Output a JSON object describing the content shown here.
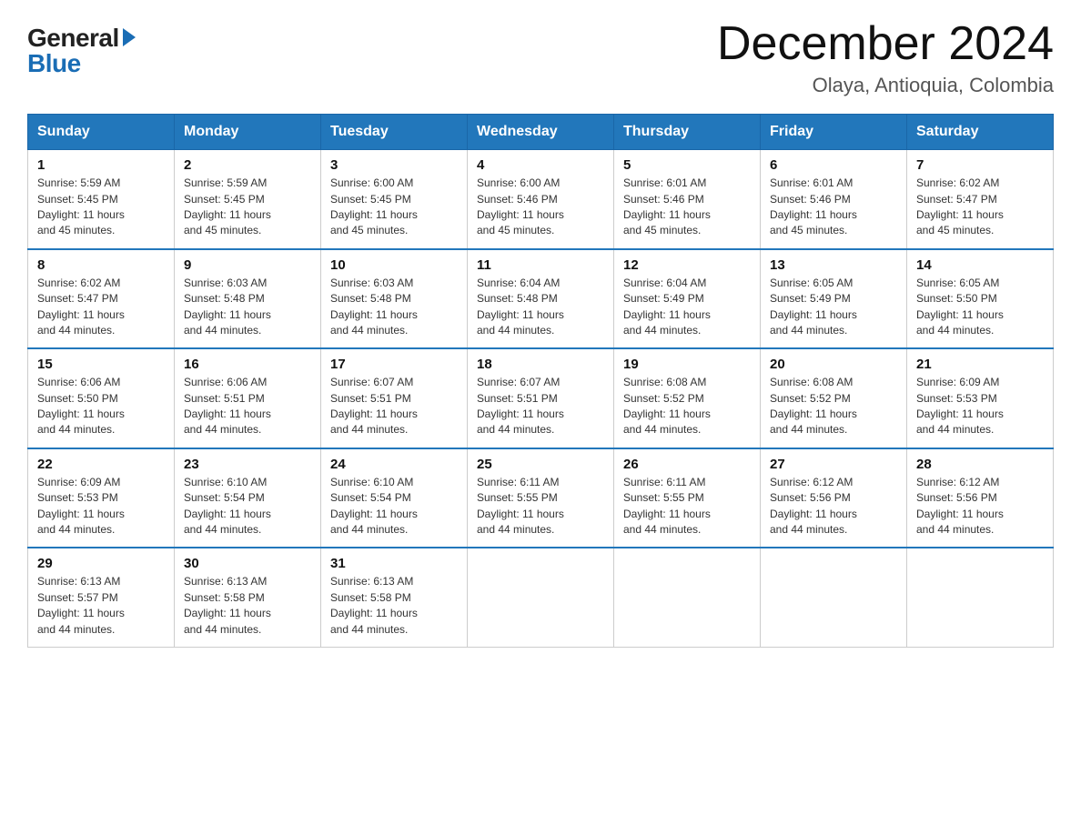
{
  "logo": {
    "general": "General",
    "blue": "Blue"
  },
  "title": "December 2024",
  "subtitle": "Olaya, Antioquia, Colombia",
  "headers": [
    "Sunday",
    "Monday",
    "Tuesday",
    "Wednesday",
    "Thursday",
    "Friday",
    "Saturday"
  ],
  "weeks": [
    [
      {
        "day": "1",
        "info": "Sunrise: 5:59 AM\nSunset: 5:45 PM\nDaylight: 11 hours\nand 45 minutes."
      },
      {
        "day": "2",
        "info": "Sunrise: 5:59 AM\nSunset: 5:45 PM\nDaylight: 11 hours\nand 45 minutes."
      },
      {
        "day": "3",
        "info": "Sunrise: 6:00 AM\nSunset: 5:45 PM\nDaylight: 11 hours\nand 45 minutes."
      },
      {
        "day": "4",
        "info": "Sunrise: 6:00 AM\nSunset: 5:46 PM\nDaylight: 11 hours\nand 45 minutes."
      },
      {
        "day": "5",
        "info": "Sunrise: 6:01 AM\nSunset: 5:46 PM\nDaylight: 11 hours\nand 45 minutes."
      },
      {
        "day": "6",
        "info": "Sunrise: 6:01 AM\nSunset: 5:46 PM\nDaylight: 11 hours\nand 45 minutes."
      },
      {
        "day": "7",
        "info": "Sunrise: 6:02 AM\nSunset: 5:47 PM\nDaylight: 11 hours\nand 45 minutes."
      }
    ],
    [
      {
        "day": "8",
        "info": "Sunrise: 6:02 AM\nSunset: 5:47 PM\nDaylight: 11 hours\nand 44 minutes."
      },
      {
        "day": "9",
        "info": "Sunrise: 6:03 AM\nSunset: 5:48 PM\nDaylight: 11 hours\nand 44 minutes."
      },
      {
        "day": "10",
        "info": "Sunrise: 6:03 AM\nSunset: 5:48 PM\nDaylight: 11 hours\nand 44 minutes."
      },
      {
        "day": "11",
        "info": "Sunrise: 6:04 AM\nSunset: 5:48 PM\nDaylight: 11 hours\nand 44 minutes."
      },
      {
        "day": "12",
        "info": "Sunrise: 6:04 AM\nSunset: 5:49 PM\nDaylight: 11 hours\nand 44 minutes."
      },
      {
        "day": "13",
        "info": "Sunrise: 6:05 AM\nSunset: 5:49 PM\nDaylight: 11 hours\nand 44 minutes."
      },
      {
        "day": "14",
        "info": "Sunrise: 6:05 AM\nSunset: 5:50 PM\nDaylight: 11 hours\nand 44 minutes."
      }
    ],
    [
      {
        "day": "15",
        "info": "Sunrise: 6:06 AM\nSunset: 5:50 PM\nDaylight: 11 hours\nand 44 minutes."
      },
      {
        "day": "16",
        "info": "Sunrise: 6:06 AM\nSunset: 5:51 PM\nDaylight: 11 hours\nand 44 minutes."
      },
      {
        "day": "17",
        "info": "Sunrise: 6:07 AM\nSunset: 5:51 PM\nDaylight: 11 hours\nand 44 minutes."
      },
      {
        "day": "18",
        "info": "Sunrise: 6:07 AM\nSunset: 5:51 PM\nDaylight: 11 hours\nand 44 minutes."
      },
      {
        "day": "19",
        "info": "Sunrise: 6:08 AM\nSunset: 5:52 PM\nDaylight: 11 hours\nand 44 minutes."
      },
      {
        "day": "20",
        "info": "Sunrise: 6:08 AM\nSunset: 5:52 PM\nDaylight: 11 hours\nand 44 minutes."
      },
      {
        "day": "21",
        "info": "Sunrise: 6:09 AM\nSunset: 5:53 PM\nDaylight: 11 hours\nand 44 minutes."
      }
    ],
    [
      {
        "day": "22",
        "info": "Sunrise: 6:09 AM\nSunset: 5:53 PM\nDaylight: 11 hours\nand 44 minutes."
      },
      {
        "day": "23",
        "info": "Sunrise: 6:10 AM\nSunset: 5:54 PM\nDaylight: 11 hours\nand 44 minutes."
      },
      {
        "day": "24",
        "info": "Sunrise: 6:10 AM\nSunset: 5:54 PM\nDaylight: 11 hours\nand 44 minutes."
      },
      {
        "day": "25",
        "info": "Sunrise: 6:11 AM\nSunset: 5:55 PM\nDaylight: 11 hours\nand 44 minutes."
      },
      {
        "day": "26",
        "info": "Sunrise: 6:11 AM\nSunset: 5:55 PM\nDaylight: 11 hours\nand 44 minutes."
      },
      {
        "day": "27",
        "info": "Sunrise: 6:12 AM\nSunset: 5:56 PM\nDaylight: 11 hours\nand 44 minutes."
      },
      {
        "day": "28",
        "info": "Sunrise: 6:12 AM\nSunset: 5:56 PM\nDaylight: 11 hours\nand 44 minutes."
      }
    ],
    [
      {
        "day": "29",
        "info": "Sunrise: 6:13 AM\nSunset: 5:57 PM\nDaylight: 11 hours\nand 44 minutes."
      },
      {
        "day": "30",
        "info": "Sunrise: 6:13 AM\nSunset: 5:58 PM\nDaylight: 11 hours\nand 44 minutes."
      },
      {
        "day": "31",
        "info": "Sunrise: 6:13 AM\nSunset: 5:58 PM\nDaylight: 11 hours\nand 44 minutes."
      },
      null,
      null,
      null,
      null
    ]
  ]
}
